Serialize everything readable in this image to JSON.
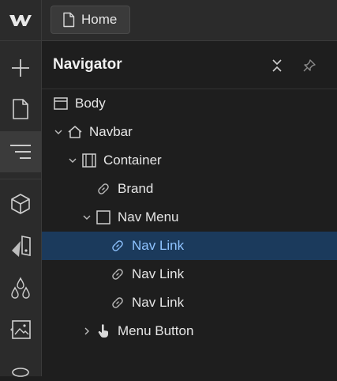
{
  "topbar": {
    "home_label": "Home"
  },
  "navigator": {
    "title": "Navigator",
    "rows": [
      {
        "label": "Body"
      },
      {
        "label": "Navbar"
      },
      {
        "label": "Container"
      },
      {
        "label": "Brand"
      },
      {
        "label": "Nav Menu"
      },
      {
        "label": "Nav Link"
      },
      {
        "label": "Nav Link"
      },
      {
        "label": "Nav Link"
      },
      {
        "label": "Menu Button"
      }
    ]
  },
  "colors": {
    "accent": "#8fc3ff",
    "selected_bg": "#1b3a5c"
  }
}
